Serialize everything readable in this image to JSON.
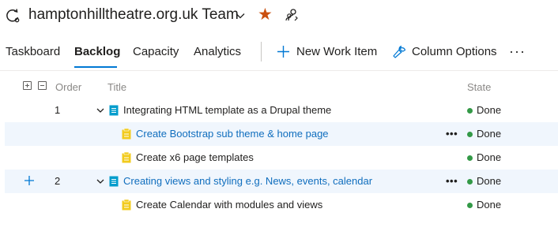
{
  "header": {
    "team_name": "hamptonhilltheatre.org.uk Team",
    "favorite_glyph": "★",
    "icons": [
      "team-switch-icon",
      "chevron-down-icon",
      "star-icon",
      "people-settings-icon"
    ],
    "favorite_color": "#ca5010"
  },
  "tabs": [
    {
      "label": "Taskboard",
      "active": false
    },
    {
      "label": "Backlog",
      "active": true
    },
    {
      "label": "Capacity",
      "active": false
    },
    {
      "label": "Analytics",
      "active": false
    }
  ],
  "toolbar": {
    "new_work_item": "New Work Item",
    "column_options": "Column Options",
    "more": "···"
  },
  "grid": {
    "columns": {
      "order": "Order",
      "title": "Title",
      "state": "State"
    },
    "rows": [
      {
        "order": "1",
        "title": "Integrating HTML template as a Drupal theme",
        "state": "Done",
        "type": "product-backlog-item",
        "level": 0
      },
      {
        "order": "",
        "title": "Create Bootstrap sub theme & home page",
        "state": "Done",
        "type": "task",
        "level": 1
      },
      {
        "order": "",
        "title": "Create x6 page templates",
        "state": "Done",
        "type": "task",
        "level": 1
      },
      {
        "order": "2",
        "title": "Creating views and styling e.g. News, events, calendar",
        "state": "Done",
        "type": "product-backlog-item",
        "level": 0
      },
      {
        "order": "",
        "title": "Create Calendar with modules and views",
        "state": "Done",
        "type": "task",
        "level": 1
      }
    ],
    "row_more": "•••"
  },
  "colors": {
    "accent": "#0078d4",
    "link": "#106ebe",
    "done_green": "#339947",
    "pbi_blue": "#009ccc",
    "task_yellow": "#f2cb1d",
    "row_highlight": "#f0f6fd"
  }
}
